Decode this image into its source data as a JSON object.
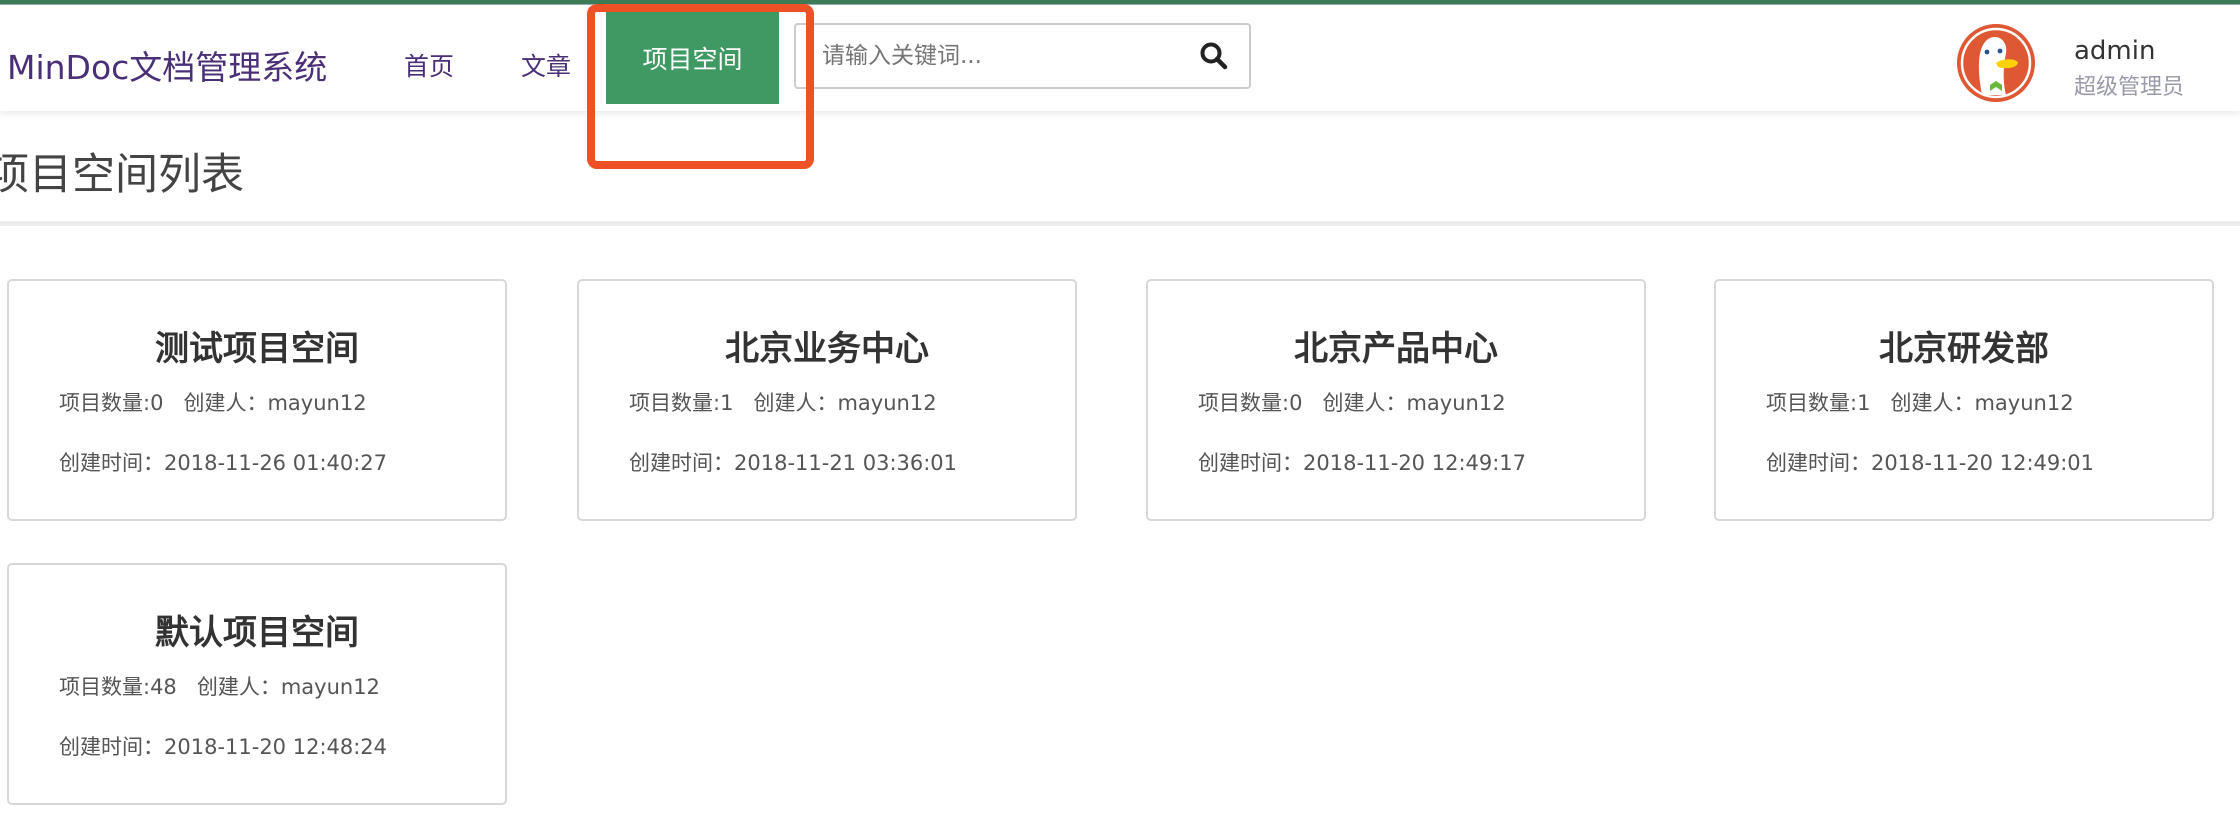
{
  "header": {
    "brand": "MinDoc文档管理系统",
    "nav": [
      {
        "label": "首页"
      },
      {
        "label": "文章"
      },
      {
        "label": "项目空间",
        "active": true
      }
    ],
    "search": {
      "placeholder": "请输入关键词...",
      "value": "",
      "icon": "search-icon"
    },
    "user": {
      "name": "admin",
      "role": "超级管理员",
      "avatar": "duck-avatar"
    },
    "accent_color": "#3f9963",
    "highlight_color": "#ef5126"
  },
  "page": {
    "title": "项目空间列表",
    "cards": [
      {
        "title": "测试项目空间",
        "project_count": "项目数量:0",
        "creator": "创建人：mayun12",
        "created": "创建时间：2018-11-26 01:40:27"
      },
      {
        "title": "北京业务中心",
        "project_count": "项目数量:1",
        "creator": "创建人：mayun12",
        "created": "创建时间：2018-11-21 03:36:01"
      },
      {
        "title": "北京产品中心",
        "project_count": "项目数量:0",
        "creator": "创建人：mayun12",
        "created": "创建时间：2018-11-20 12:49:17"
      },
      {
        "title": "北京研发部",
        "project_count": "项目数量:1",
        "creator": "创建人：mayun12",
        "created": "创建时间：2018-11-20 12:49:01"
      },
      {
        "title": "默认项目空间",
        "project_count": "项目数量:48",
        "creator": "创建人：mayun12",
        "created": "创建时间：2018-11-20 12:48:24"
      }
    ]
  }
}
